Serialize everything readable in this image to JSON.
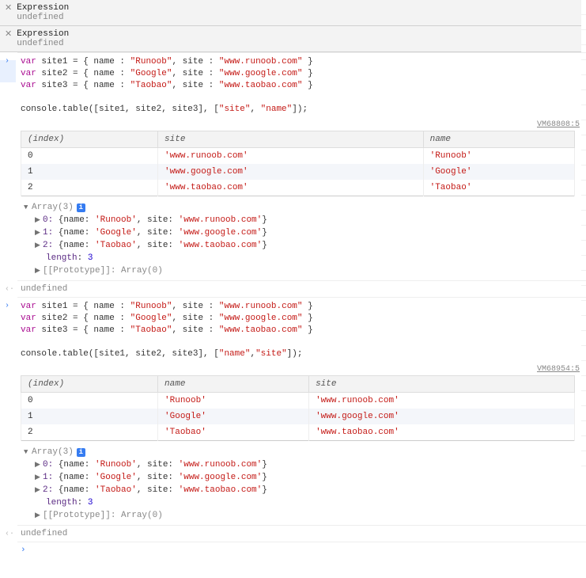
{
  "watches": [
    {
      "expr": "Expression",
      "value": "undefined"
    },
    {
      "expr": "Expression",
      "value": "undefined"
    }
  ],
  "block1": {
    "code": [
      "var site1 = { name : \"Runoob\", site : \"www.runoob.com\" }",
      "var site2 = { name : \"Google\", site : \"www.google.com\" }",
      "var site3 = { name : \"Taobao\", site : \"www.taobao.com\" }",
      "",
      "console.table([site1, site2, site3], [\"site\", \"name\"]);"
    ],
    "vm": "VM68808:5",
    "table": {
      "headers": [
        "(index)",
        "site",
        "name"
      ],
      "rows": [
        {
          "idx": "0",
          "c1": "'www.runoob.com'",
          "c2": "'Runoob'"
        },
        {
          "idx": "1",
          "c1": "'www.google.com'",
          "c2": "'Google'"
        },
        {
          "idx": "2",
          "c1": "'www.taobao.com'",
          "c2": "'Taobao'"
        }
      ]
    },
    "array_label": "Array(3)",
    "items": [
      {
        "k": "0:",
        "name": "'Runoob'",
        "site": "'www.runoob.com'"
      },
      {
        "k": "1:",
        "name": "'Google'",
        "site": "'www.google.com'"
      },
      {
        "k": "2:",
        "name": "'Taobao'",
        "site": "'www.taobao.com'"
      }
    ],
    "length_label": "length",
    "length_val": "3",
    "proto": "[[Prototype]]: Array(0)",
    "result": "undefined"
  },
  "block2": {
    "code": [
      "var site1 = { name : \"Runoob\", site : \"www.runoob.com\" }",
      "var site2 = { name : \"Google\", site : \"www.google.com\" }",
      "var site3 = { name : \"Taobao\", site : \"www.taobao.com\" }",
      "",
      "console.table([site1, site2, site3], [\"name\",\"site\"]);"
    ],
    "vm": "VM68954:5",
    "table": {
      "headers": [
        "(index)",
        "name",
        "site"
      ],
      "rows": [
        {
          "idx": "0",
          "c1": "'Runoob'",
          "c2": "'www.runoob.com'"
        },
        {
          "idx": "1",
          "c1": "'Google'",
          "c2": "'www.google.com'"
        },
        {
          "idx": "2",
          "c1": "'Taobao'",
          "c2": "'www.taobao.com'"
        }
      ]
    },
    "array_label": "Array(3)",
    "items": [
      {
        "k": "0:",
        "name": "'Runoob'",
        "site": "'www.runoob.com'"
      },
      {
        "k": "1:",
        "name": "'Google'",
        "site": "'www.google.com'"
      },
      {
        "k": "2:",
        "name": "'Taobao'",
        "site": "'www.taobao.com'"
      }
    ],
    "length_label": "length",
    "length_val": "3",
    "proto": "[[Prototype]]: Array(0)",
    "result": "undefined"
  },
  "labels": {
    "name": "name",
    "site": "site"
  }
}
